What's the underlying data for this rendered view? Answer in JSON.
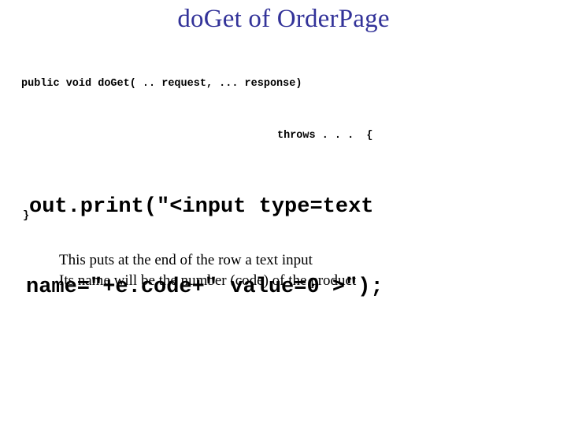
{
  "slide": {
    "title": "doGet of OrderPage",
    "title_color": "#333399",
    "background_color": "#ffffff",
    "body_text_color": "#000000"
  },
  "code_signature": {
    "line_1": "public void doGet( .. request, ... response)",
    "line_2": "throws . . .  {"
  },
  "code_main": {
    "line_1": "out.print(\"<input type=text",
    "line_2": "name=\"+e.code+\" value=0 >\");"
  },
  "code_close": {
    "brace": "}"
  },
  "notes": {
    "line_1": "This puts at the end of the row a text input",
    "line_2": "Its name will be the number (code) of the product"
  }
}
